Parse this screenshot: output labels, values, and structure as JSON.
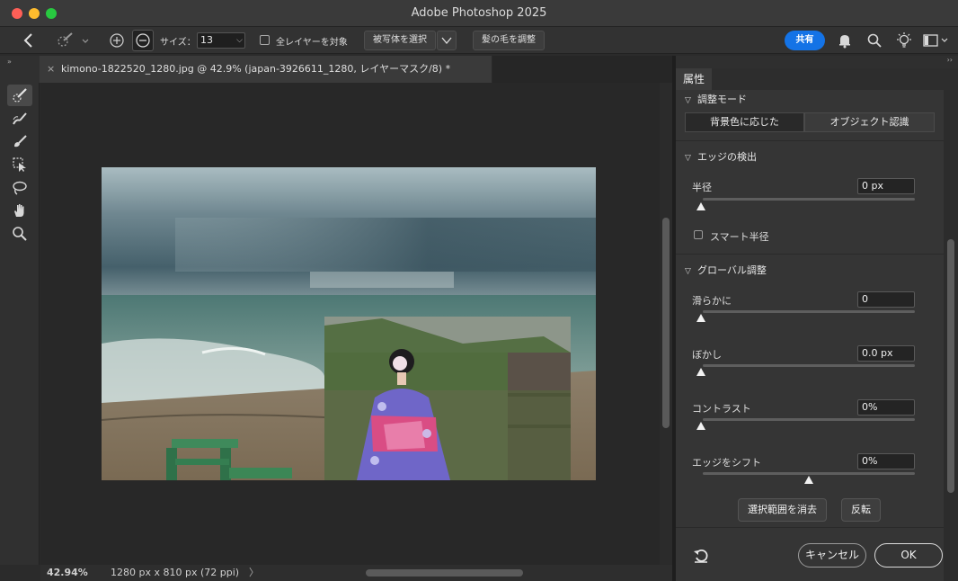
{
  "window": {
    "title": "Adobe Photoshop 2025"
  },
  "options_bar": {
    "size_label": "サイズ：",
    "size_value": "13",
    "sample_all_layers_label": "全レイヤーを対象",
    "select_subject_label": "被写体を選択",
    "refine_hair_label": "髪の毛を調整",
    "share_label": "共有"
  },
  "document": {
    "tab_title": "kimono-1822520_1280.jpg @ 42.9% (japan-3926611_1280, レイヤーマスク/8) *"
  },
  "status_bar": {
    "zoom": "42.94%",
    "dimensions": "1280 px x 810 px (72 ppi)",
    "chevron": "〉"
  },
  "panel": {
    "tab_label": "属性",
    "adjust_mode": {
      "heading": "調整モード",
      "option_color": "背景色に応じた",
      "option_object": "オブジェクト認識"
    },
    "edge_detection": {
      "heading": "エッジの検出",
      "radius_label": "半径",
      "radius_value": "0 px",
      "radius_level": 0,
      "smart_radius_label": "スマート半径"
    },
    "global_refinements": {
      "heading": "グローバル調整",
      "smooth_label": "滑らかに",
      "smooth_value": "0",
      "smooth_level": 0,
      "feather_label": "ぼかし",
      "feather_value": "0.0 px",
      "feather_level": 0,
      "contrast_label": "コントラスト",
      "contrast_value": "0%",
      "contrast_level": 0,
      "shift_edge_label": "エッジをシフト",
      "shift_edge_value": "0%",
      "shift_edge_level": 0.5
    },
    "buttons": {
      "clear_selection": "選択範囲を消去",
      "invert": "反転",
      "cancel": "キャンセル",
      "ok": "OK"
    }
  },
  "colors": {
    "accent": "#1473e6",
    "panel_bg": "#353535",
    "canvas_bg": "#282828"
  }
}
